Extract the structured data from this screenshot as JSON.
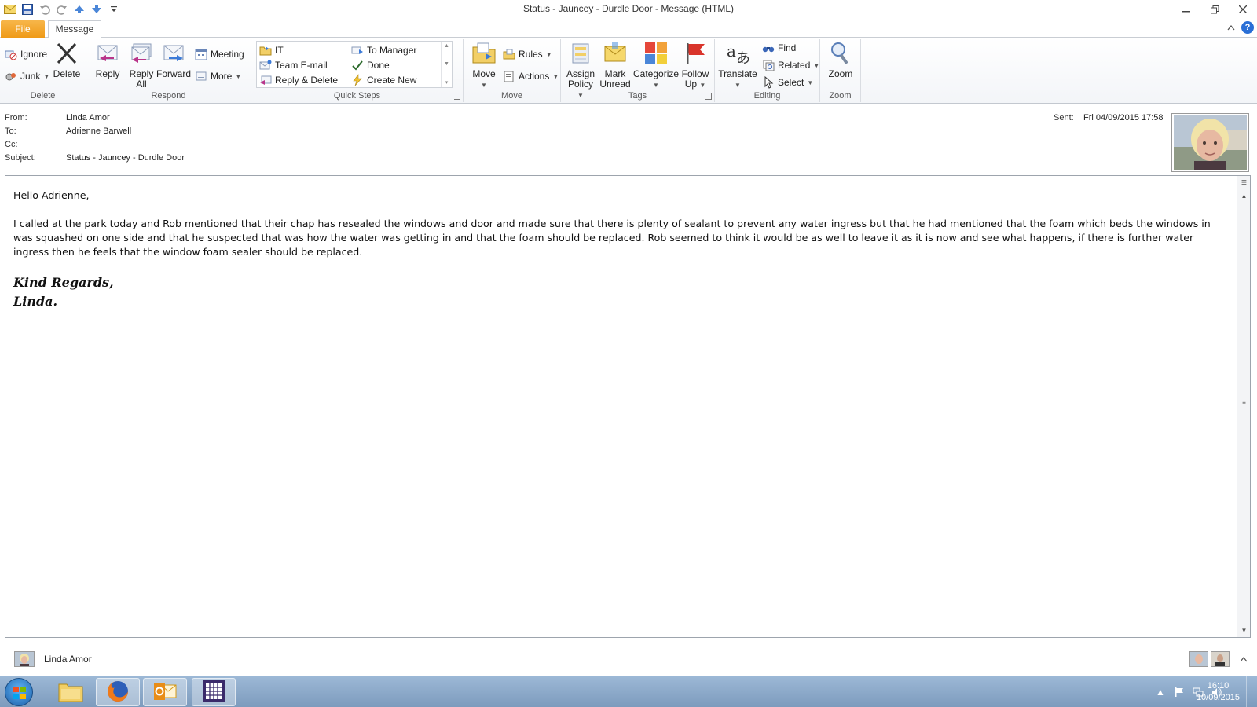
{
  "window": {
    "title": "Status - Jauncey - Durdle Door  -  Message (HTML)",
    "minimize_icon": "minimize-icon",
    "restore_icon": "restore-icon",
    "close_icon": "close-icon"
  },
  "tabs": {
    "file": "File",
    "message": "Message"
  },
  "ribbon": {
    "delete_group": {
      "label": "Delete",
      "ignore": "Ignore",
      "junk": "Junk",
      "delete": "Delete"
    },
    "respond_group": {
      "label": "Respond",
      "reply": "Reply",
      "reply_all_1": "Reply",
      "reply_all_2": "All",
      "forward": "Forward",
      "meeting": "Meeting",
      "more": "More"
    },
    "quick_steps_group": {
      "label": "Quick Steps",
      "items": [
        "IT",
        "To Manager",
        "Team E-mail",
        "Done",
        "Reply & Delete",
        "Create New"
      ]
    },
    "move_group": {
      "label": "Move",
      "move": "Move",
      "rules": "Rules",
      "actions": "Actions"
    },
    "tags_group": {
      "label": "Tags",
      "assign_1": "Assign",
      "assign_2": "Policy",
      "mark_1": "Mark",
      "mark_2": "Unread",
      "categorize": "Categorize",
      "follow_1": "Follow",
      "follow_2": "Up"
    },
    "editing_group": {
      "label": "Editing",
      "translate": "Translate",
      "find": "Find",
      "related": "Related",
      "select": "Select"
    },
    "zoom_group": {
      "label": "Zoom",
      "zoom": "Zoom"
    }
  },
  "header": {
    "from_label": "From:",
    "from_value": "Linda Amor",
    "to_label": "To:",
    "to_value": "Adrienne Barwell",
    "cc_label": "Cc:",
    "subject_label": "Subject:",
    "subject_value": "Status - Jauncey - Durdle Door",
    "sent_label": "Sent:",
    "sent_value": "Fri 04/09/2015 17:58"
  },
  "message": {
    "greeting": "Hello Adrienne,",
    "paragraph": "I called at the park today and Rob mentioned that their chap has resealed the windows and door and made sure that there is plenty of sealant to prevent any water ingress but that he had mentioned that the foam which beds the windows in was squashed on one side and that he suspected that was how the water was getting in and that the foam should be replaced.  Rob seemed to think it would be as well to leave it as it is now and see what happens, if there is further water ingress then he feels that the window foam sealer should be replaced.",
    "signature_1": "Kind Regards,",
    "signature_2": "Linda."
  },
  "people_pane": {
    "name": "Linda Amor"
  },
  "taskbar": {
    "time": "16:10",
    "date": "10/09/2015"
  },
  "colors": {
    "file_tab": "#ef9a17",
    "ribbon_bg": "#f3f5f8",
    "taskbar": "#8aa8c8",
    "flag_red": "#d9342b"
  }
}
